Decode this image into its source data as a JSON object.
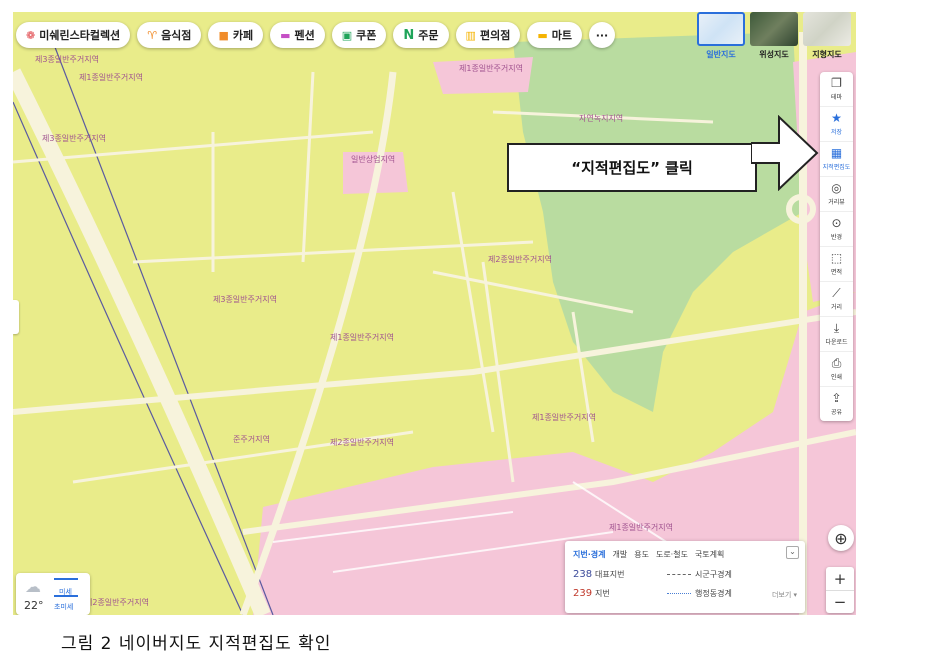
{
  "chips": [
    {
      "icon": "❁",
      "label": "미쉐린스타컬렉션",
      "color": "#e0474c"
    },
    {
      "icon": "♈",
      "label": "음식점",
      "color": "#f08c2b"
    },
    {
      "icon": "■",
      "label": "카페",
      "color": "#f08c2b"
    },
    {
      "icon": "▬",
      "label": "펜션",
      "color": "#c54fc5"
    },
    {
      "icon": "▣",
      "label": "쿠폰",
      "color": "#1fa45a"
    },
    {
      "icon": "N",
      "label": "주문",
      "color": "#1fa45a"
    },
    {
      "icon": "▥",
      "label": "편의점",
      "color": "#f5b301"
    },
    {
      "icon": "▬",
      "label": "마트",
      "color": "#f5b301"
    }
  ],
  "more_label": "···",
  "map_types": [
    {
      "label": "일반지도",
      "active": true
    },
    {
      "label": "위성지도",
      "active": false
    },
    {
      "label": "지형지도",
      "active": false
    }
  ],
  "tools": [
    {
      "icon": "❐",
      "label": "테마"
    },
    {
      "icon": "★",
      "label": "저장",
      "blue": true
    },
    {
      "icon": "▦",
      "label": "지적편집도",
      "blue": true
    },
    {
      "icon": "◎",
      "label": "거리뷰"
    },
    {
      "icon": "⊙",
      "label": "반경"
    },
    {
      "icon": "⬚",
      "label": "면적"
    },
    {
      "icon": "⟋",
      "label": "거리"
    },
    {
      "icon": "⤓",
      "label": "다운로드"
    },
    {
      "icon": "⎙",
      "label": "인쇄"
    },
    {
      "icon": "⇪",
      "label": "공유"
    }
  ],
  "callout": "“지적편집도” 클릭",
  "zone_labels": [
    "제3종일반주거지역",
    "제1종일반주거지역",
    "제3종일반주거지역",
    "제1종일반주거지역",
    "자연녹지지역",
    "일반상업지역",
    "제2종일반주거지역",
    "제3종일반주거지역",
    "제1종일반주거지역",
    "제1종일반주거지역",
    "준주거지역",
    "제2종일반주거지역",
    "제1종일반주거지역",
    "제2종일반주거지역"
  ],
  "legend": {
    "tabs": [
      "지번·경계",
      "개발",
      "용도",
      "도로·철도",
      "국토계획"
    ],
    "rows": [
      {
        "num": "238",
        "desc": "대표지번",
        "line": "시군구경계"
      },
      {
        "num": "239",
        "desc": "지번",
        "line": "행정동경계"
      }
    ],
    "more": "더보기 ▾",
    "collapse": "⌄"
  },
  "weather": {
    "temp": "22°",
    "dust1": "미세",
    "dust2": "초미세"
  },
  "zoom": {
    "in": "+",
    "out": "−"
  },
  "locate_icon": "⊕",
  "caption": "그림 2 네이버지도 지적편집도 확인",
  "colors": {
    "residential": "#e9ec8a",
    "commercial": "#f5c6d8",
    "green": "#b9dca0",
    "road": "#f7f3dc"
  }
}
